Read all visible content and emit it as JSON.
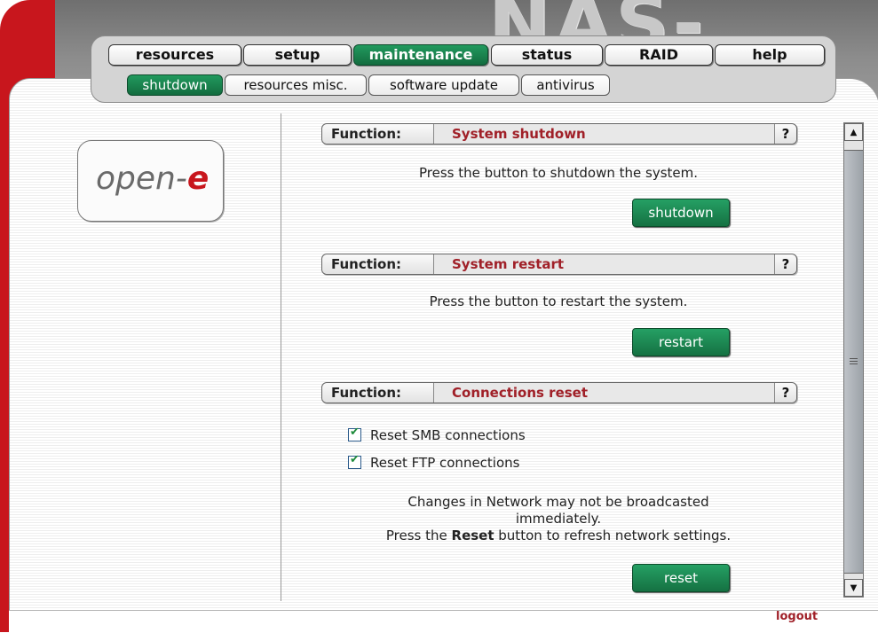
{
  "brand": "NAS-XSR",
  "nav": {
    "main_tabs": [
      {
        "label": "resources"
      },
      {
        "label": "setup"
      },
      {
        "label": "maintenance",
        "active": true
      },
      {
        "label": "status"
      },
      {
        "label": "RAID"
      },
      {
        "label": "help"
      }
    ],
    "sub_tabs": [
      {
        "label": "shutdown",
        "active": true
      },
      {
        "label": "resources misc."
      },
      {
        "label": "software update"
      },
      {
        "label": "antivirus"
      }
    ]
  },
  "logo": {
    "text": "open-",
    "accent": "e"
  },
  "sections": [
    {
      "function_label": "Function:",
      "title": "System shutdown",
      "help": "?",
      "description": "Press the button to shutdown the system.",
      "button": "shutdown"
    },
    {
      "function_label": "Function:",
      "title": "System restart",
      "help": "?",
      "description": "Press the button to restart the system.",
      "button": "restart"
    },
    {
      "function_label": "Function:",
      "title": "Connections reset",
      "help": "?",
      "checkboxes": [
        {
          "label": "Reset SMB connections",
          "checked": true
        },
        {
          "label": "Reset FTP connections",
          "checked": true
        }
      ],
      "note_line1": "Changes in Network may not be broadcasted",
      "note_line2": "immediately.",
      "note_line3_pre": "Press the ",
      "note_line3_bold": "Reset",
      "note_line3_post": " button to refresh network settings.",
      "button": "reset"
    }
  ],
  "logout": "logout",
  "colors": {
    "brand_red": "#c8161d",
    "active_green": "#1b8a51",
    "title_red": "#a02028"
  }
}
